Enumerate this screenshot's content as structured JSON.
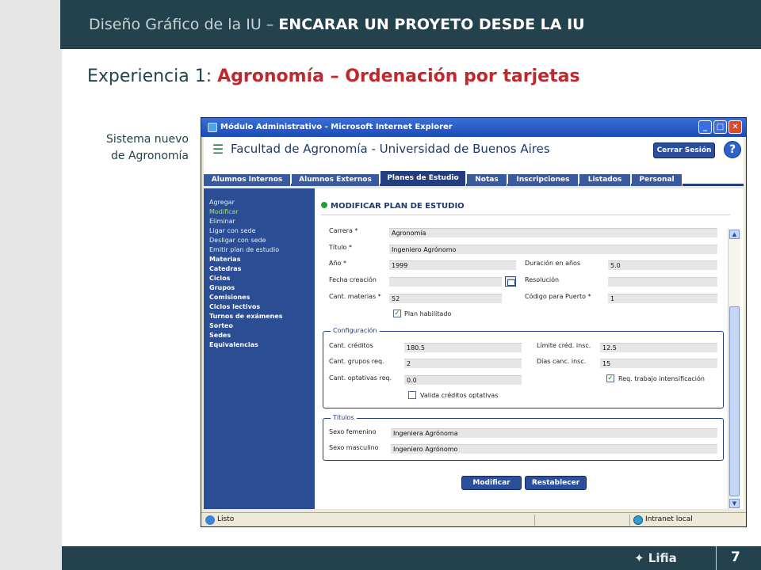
{
  "slide": {
    "header_light": "Diseño Gráfico de la IU –",
    "header_bold": "ENCARAR UN PROYETO DESDE LA IU",
    "subtitle_prefix": "Experiencia 1:",
    "subtitle_highlight": "Agronomía – Ordenación por tarjetas",
    "note_line1": "Sistema nuevo",
    "note_line2": "de Agronomía",
    "brand": "Lifia",
    "page_number": "7"
  },
  "window": {
    "title": "Módulo Administrativo - Microsoft Internet Explorer",
    "buttons": {
      "minimize": "_",
      "maximize": "□",
      "close": "✕"
    }
  },
  "app": {
    "title": "Facultad de Agronomía - Universidad de Buenos Aires",
    "logout_label": "Cerrar Sesión",
    "help_label": "?"
  },
  "tabs": [
    {
      "label": "Alumnos Internos",
      "active": false
    },
    {
      "label": "Alumnos Externos",
      "active": false
    },
    {
      "label": "Planes de Estudio",
      "active": true
    },
    {
      "label": "Notas",
      "active": false
    },
    {
      "label": "Inscripciones",
      "active": false
    },
    {
      "label": "Listados",
      "active": false
    },
    {
      "label": "Personal",
      "active": false
    }
  ],
  "sidebar": {
    "actions": [
      "Agregar",
      "Modificar",
      "Eliminar",
      "Ligar con sede",
      "Desligar con sede",
      "Emitir plan de estudio"
    ],
    "selected_action": "Modificar",
    "sections": [
      "Materias",
      "Catedras",
      "Ciclos",
      "Grupos",
      "Comisiones",
      "Ciclos lectivos",
      "Turnos de exámenes",
      "Sorteo",
      "Sedes",
      "Equivalencias"
    ]
  },
  "form": {
    "title": "MODIFICAR PLAN DE ESTUDIO",
    "carrera": {
      "label": "Carrera *",
      "value": "Agronomía"
    },
    "titulo": {
      "label": "Título *",
      "value": "Ingeniero Agrónomo"
    },
    "anio": {
      "label": "Año *",
      "value": "1999"
    },
    "duracion": {
      "label": "Duración en años",
      "value": "5.0"
    },
    "fecha_creacion": {
      "label": "Fecha creación",
      "value": ""
    },
    "resolucion": {
      "label": "Resolución",
      "value": ""
    },
    "cant_materias": {
      "label": "Cant. materias *",
      "value": "52"
    },
    "codigo_puerto": {
      "label": "Código para Puerto *",
      "value": "1"
    },
    "plan_habilitado": {
      "label": "Plan habilitado",
      "checked": true
    }
  },
  "configuracion": {
    "legend": "Configuración",
    "cant_creditos": {
      "label": "Cant. créditos",
      "value": "180.5"
    },
    "limite_cred": {
      "label": "Límite créd. insc.",
      "value": "12.5"
    },
    "cant_grupos": {
      "label": "Cant. grupos req.",
      "value": "2"
    },
    "dias_canc": {
      "label": "Días canc. insc.",
      "value": "15"
    },
    "cant_optativas": {
      "label": "Cant. optativas req.",
      "value": "0.0"
    },
    "req_trabajo": {
      "label": "Req. trabajo intensificación",
      "checked": true
    },
    "valida_creditos": {
      "label": "Valida créditos optativas",
      "checked": false
    }
  },
  "titulos": {
    "legend": "Títulos",
    "sexo_femenino": {
      "label": "Sexo femenino",
      "value": "Ingeniera Agrónoma"
    },
    "sexo_masculino": {
      "label": "Sexo masculino",
      "value": "Ingeniero Agrónomo"
    }
  },
  "actions": {
    "modify_label": "Modificar",
    "reset_label": "Restablecer"
  },
  "status_bar": {
    "status": "Listo",
    "zone": "Intranet local"
  },
  "colors": {
    "header_bg": "#23424e",
    "accent_red": "#c0282d",
    "app_blue": "#2b4d94",
    "tab_blue": "#3a5a9f"
  }
}
